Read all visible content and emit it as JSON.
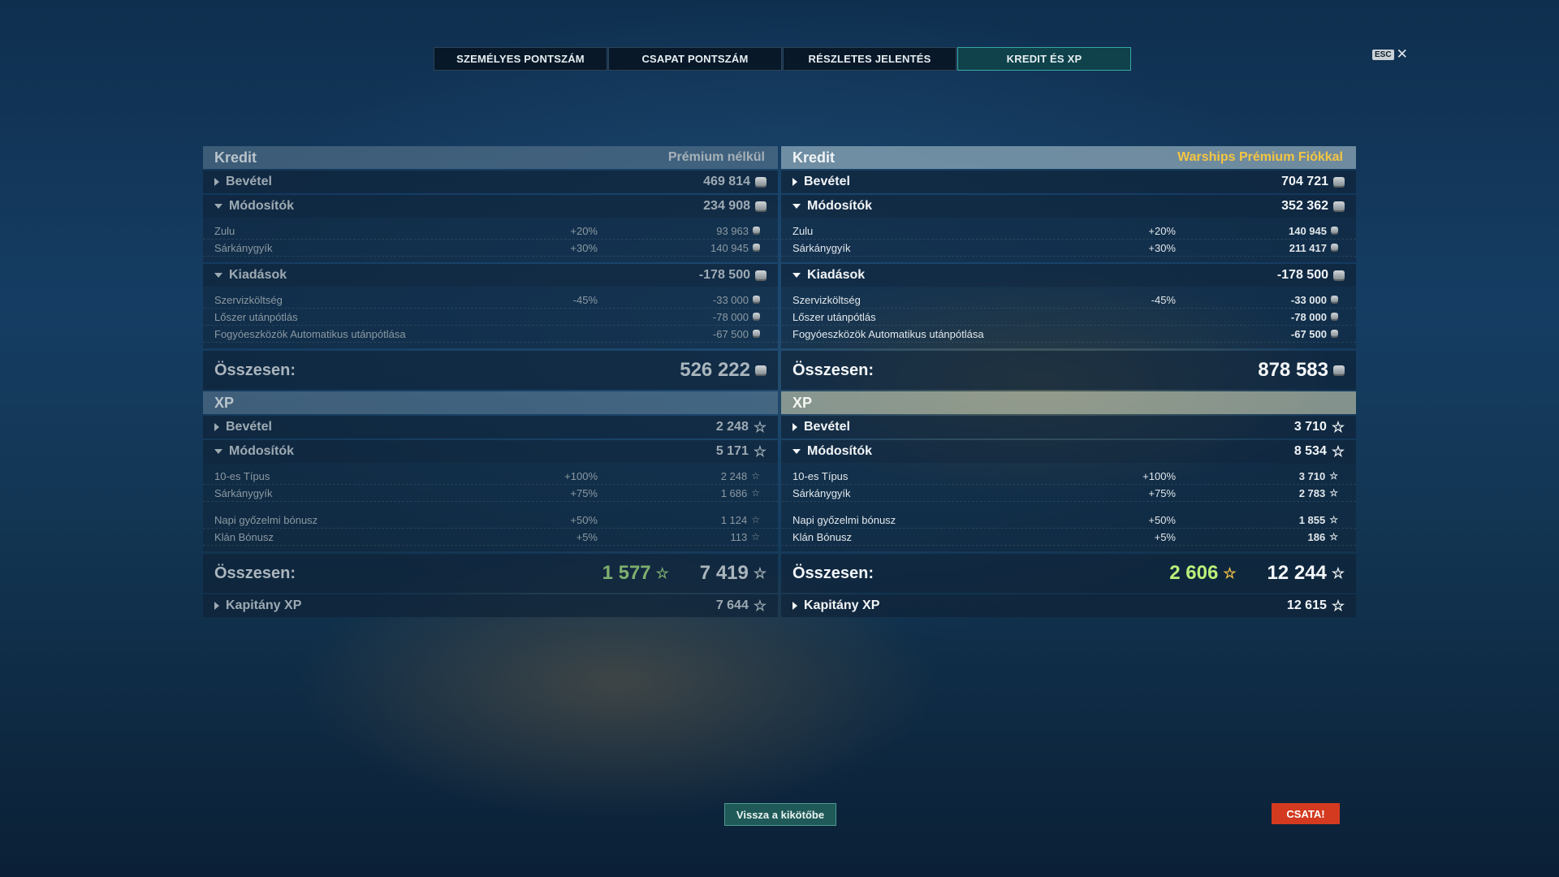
{
  "tabs": [
    {
      "label": "SZEMÉLYES PONTSZÁM"
    },
    {
      "label": "CSAPAT PONTSZÁM"
    },
    {
      "label": "RÉSZLETES JELENTÉS"
    },
    {
      "label": "KREDIT ÉS XP"
    }
  ],
  "esc_label": "ESC",
  "left": {
    "kredit_title": "Kredit",
    "premium_label": "Prémium nélkül",
    "bevetel": {
      "label": "Bevétel",
      "value": "469 814"
    },
    "modositok": {
      "label": "Módosítók",
      "value": "234 908",
      "items": [
        {
          "name": "Zulu",
          "pct": "+20%",
          "value": "93 963"
        },
        {
          "name": "Sárkánygyík",
          "pct": "+30%",
          "value": "140 945"
        }
      ]
    },
    "kiadasok": {
      "label": "Kiadások",
      "value": "-178 500",
      "items": [
        {
          "name": "Szervizköltség",
          "pct": "-45%",
          "value": "-33 000"
        },
        {
          "name": "Lőszer utánpótlás",
          "pct": "",
          "value": "-78 000"
        },
        {
          "name": "Fogyóeszközök Automatikus utánpótlása",
          "pct": "",
          "value": "-67 500"
        }
      ]
    },
    "osszesen_label": "Összesen:",
    "kredit_total": "526 222",
    "xp_title": "XP",
    "xp_bevetel": {
      "label": "Bevétel",
      "value": "2 248"
    },
    "xp_modositok": {
      "label": "Módosítók",
      "value": "5 171",
      "items": [
        {
          "name": "10-es Típus",
          "pct": "+100%",
          "value": "2 248"
        },
        {
          "name": "Sárkánygyík",
          "pct": "+75%",
          "value": "1 686"
        },
        {
          "name": "Napi győzelmi bónusz",
          "pct": "+50%",
          "value": "1 124"
        },
        {
          "name": "Klán Bónusz",
          "pct": "+5%",
          "value": "113"
        }
      ]
    },
    "xp_free_total": "1 577",
    "xp_total": "7 419",
    "kapitany": {
      "label": "Kapitány XP",
      "value": "7 644"
    }
  },
  "right": {
    "kredit_title": "Kredit",
    "premium_label": "Warships Prémium Fiókkal",
    "bevetel": {
      "label": "Bevétel",
      "value": "704 721"
    },
    "modositok": {
      "label": "Módosítók",
      "value": "352 362",
      "items": [
        {
          "name": "Zulu",
          "pct": "+20%",
          "value": "140 945"
        },
        {
          "name": "Sárkánygyík",
          "pct": "+30%",
          "value": "211 417"
        }
      ]
    },
    "kiadasok": {
      "label": "Kiadások",
      "value": "-178 500",
      "items": [
        {
          "name": "Szervizköltség",
          "pct": "-45%",
          "value": "-33 000"
        },
        {
          "name": "Lőszer utánpótlás",
          "pct": "",
          "value": "-78 000"
        },
        {
          "name": "Fogyóeszközök Automatikus utánpótlása",
          "pct": "",
          "value": "-67 500"
        }
      ]
    },
    "osszesen_label": "Összesen:",
    "kredit_total": "878 583",
    "xp_title": "XP",
    "xp_bevetel": {
      "label": "Bevétel",
      "value": "3 710"
    },
    "xp_modositok": {
      "label": "Módosítók",
      "value": "8 534",
      "items": [
        {
          "name": "10-es Típus",
          "pct": "+100%",
          "value": "3 710"
        },
        {
          "name": "Sárkánygyík",
          "pct": "+75%",
          "value": "2 783"
        },
        {
          "name": "Napi győzelmi bónusz",
          "pct": "+50%",
          "value": "1 855"
        },
        {
          "name": "Klán Bónusz",
          "pct": "+5%",
          "value": "186"
        }
      ]
    },
    "xp_free_total": "2 606",
    "xp_total": "12 244",
    "kapitany": {
      "label": "Kapitány XP",
      "value": "12 615"
    }
  },
  "buttons": {
    "back": "Vissza a kikötőbe",
    "battle": "CSATA!"
  },
  "icons": {
    "credit": "credit-coin-icon",
    "xp": "star-icon",
    "free_xp": "star-icon"
  },
  "colors": {
    "premium_gold": "#f5c542",
    "battle_red": "#d33a1f",
    "active_tab": "#10444a",
    "free_xp_green": "#b9f07a"
  }
}
